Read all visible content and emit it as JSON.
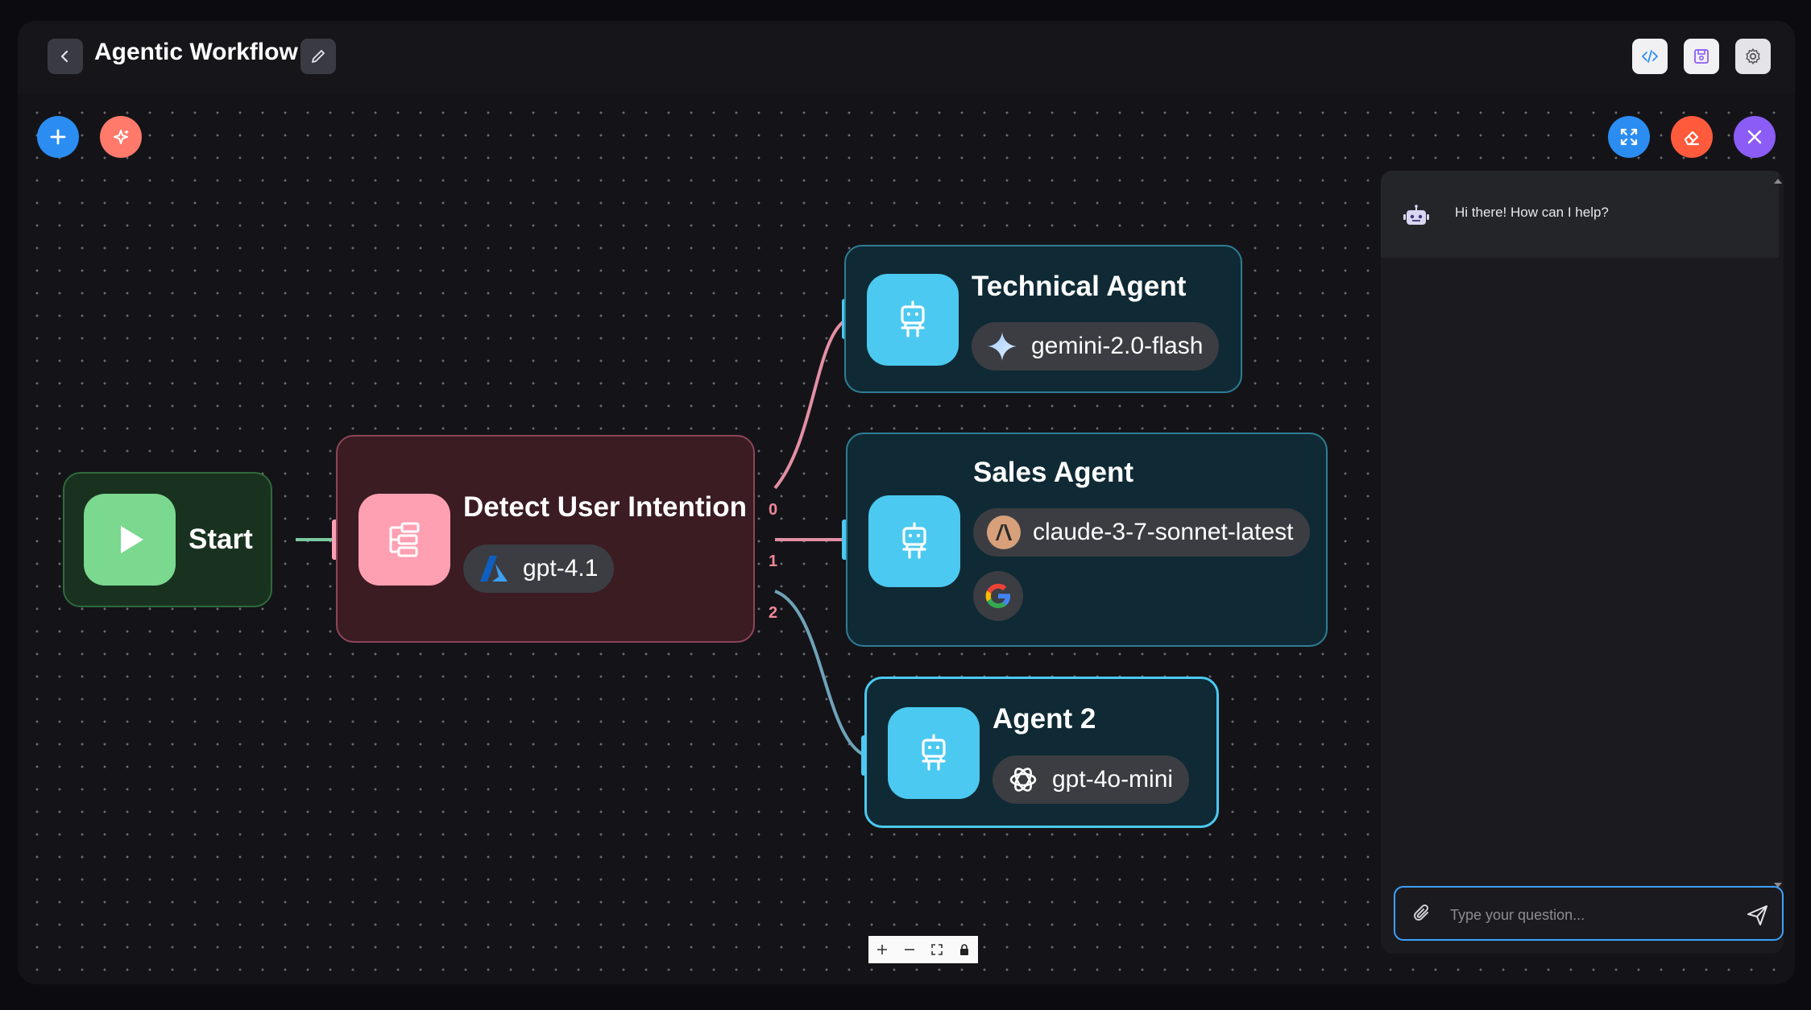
{
  "header": {
    "title": "Agentic Workflow"
  },
  "nodes": {
    "start": {
      "label": "Start"
    },
    "router": {
      "title": "Detect User Intention",
      "model": "gpt-4.1",
      "outputs": [
        "0",
        "1",
        "2"
      ]
    },
    "technical": {
      "title": "Technical Agent",
      "model": "gemini-2.0-flash"
    },
    "sales": {
      "title": "Sales Agent",
      "model": "claude-3-7-sonnet-latest"
    },
    "agent2": {
      "title": "Agent 2",
      "model": "gpt-4o-mini"
    }
  },
  "chat": {
    "greeting": "Hi there! How can I help?",
    "placeholder": "Type your question..."
  },
  "colors": {
    "accent": "#3da0ff",
    "start_green": "#7bd88f",
    "router_pink": "#ff9fb2",
    "agent_cyan": "#4cc9f0",
    "add_button": "#2b8df2",
    "magic_button": "#ff7a6b",
    "clear_button": "#ff5a3c",
    "close_button": "#8b5cf6"
  },
  "icons": {
    "back": "chevron-left-icon",
    "edit": "pencil-icon",
    "code": "code-icon",
    "save": "save-icon",
    "settings": "gear-icon",
    "add": "plus-icon",
    "magic": "sparkles-icon",
    "fit": "expand-icon",
    "clear": "eraser-icon",
    "close": "close-icon",
    "attach": "paperclip-icon",
    "send": "send-icon"
  }
}
